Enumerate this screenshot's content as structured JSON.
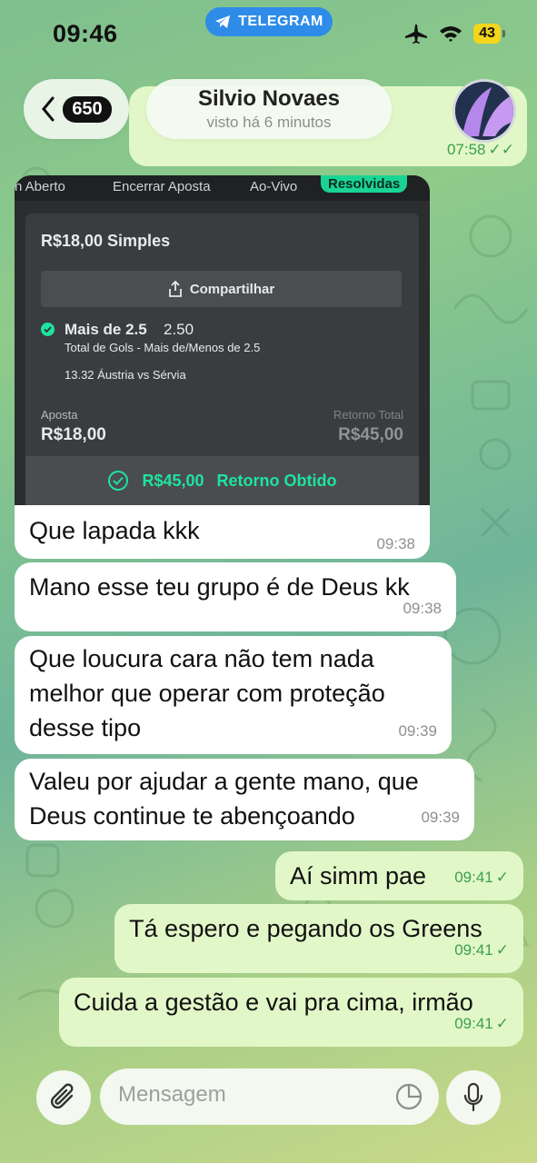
{
  "status": {
    "time": "09:46",
    "app_pill": "TELEGRAM",
    "battery": "43"
  },
  "header": {
    "back_count": "650",
    "name": "Silvio Novaes",
    "last_seen": "visto há 6 minutos"
  },
  "peek_message": {
    "time": "07:58"
  },
  "screenshot": {
    "tabs": [
      "n Aberto",
      "Encerrar Aposta",
      "Ao-Vivo",
      "Resolvidas"
    ],
    "bet_title": "R$18,00 Simples",
    "share_label": "Compartilhar",
    "selection": "Mais de 2.5",
    "odds": "2.50",
    "market": "Total de Gols - Mais de/Menos de 2.5",
    "event": "13.32 Áustria vs Sérvia",
    "stake_label": "Aposta",
    "stake_value": "R$18,00",
    "return_label": "Retorno Total",
    "return_value": "R$45,00",
    "returned_value": "R$45,00",
    "returned_label": "Retorno Obtido"
  },
  "messages": [
    {
      "text": "Que lapada kkk",
      "time": "09:38"
    },
    {
      "text": "Mano esse teu grupo é de Deus kk",
      "time": "09:38"
    },
    {
      "line1": "Que loucura cara não tem nada",
      "line2": "melhor que operar com proteção",
      "line3": "desse tipo",
      "time": "09:39"
    },
    {
      "line1": "Valeu por ajudar a gente mano, que",
      "line2": "Deus continue te abençoando",
      "time": "09:39"
    },
    {
      "text": "Aí simm pae",
      "time": "09:41"
    },
    {
      "text": "Tá espero e pegando os Greens",
      "time": "09:41"
    },
    {
      "text": "Cuida a gestão e vai pra cima, irmão",
      "time": "09:41"
    }
  ],
  "composer": {
    "placeholder": "Mensagem"
  },
  "colors": {
    "accent_green": "#1ee39e",
    "out_bubble": "#e2f7c8",
    "telegram_blue": "#2e8ce8"
  },
  "icons": [
    "telegram-icon",
    "airplane-icon",
    "wifi-icon",
    "back-chevron-icon",
    "check-icon",
    "share-icon",
    "paperclip-icon",
    "sticker-icon",
    "microphone-icon"
  ]
}
